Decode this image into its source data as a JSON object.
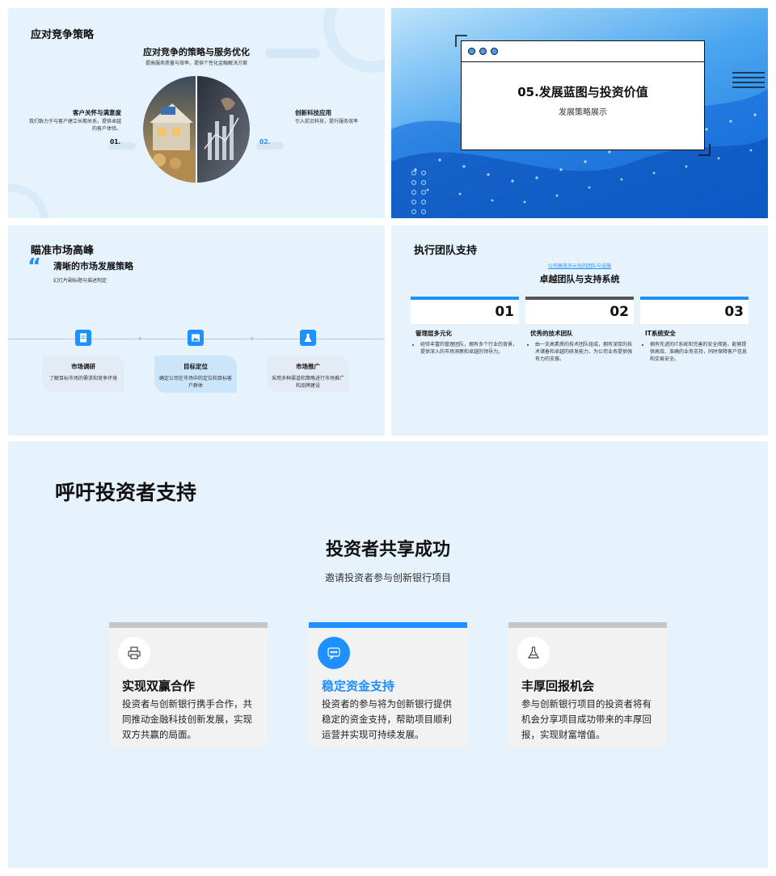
{
  "slide1": {
    "heading": "应对竞争策略",
    "title": "应对竞争的策略与服务优化",
    "subtitle": "提高服务质量与效率，提供个性化金融解决方案",
    "left": {
      "title": "客户关怀与满意度",
      "desc": "我们致力于与客户建立长期关系，提供卓越的客户体验。",
      "num": "01."
    },
    "right": {
      "title": "创新科技应用",
      "desc": "引入前沿科技，提升服务效率",
      "num": "02."
    },
    "colors": {
      "accent": "#1e90ff",
      "bg": "#e6f3fd"
    }
  },
  "slide2": {
    "title": "05.发展蓝图与投资价值",
    "subtitle": "发展策略展示"
  },
  "slide3": {
    "heading": "瞄准市场高峰",
    "quote_icon": "quote-icon",
    "title": "清晰的市场发展策略",
    "subtitle": "幻灯片副标题与描述制定",
    "steps": [
      {
        "icon": "document-icon",
        "title": "市场调研",
        "desc": "了解目标市场的需求和竞争环境"
      },
      {
        "icon": "image-icon",
        "title": "目标定位",
        "desc": "确定公司在市场中的定位和目标客户群体"
      },
      {
        "icon": "flask-icon",
        "title": "市场推广",
        "desc": "采用多种渠道和策略进行市场推广和品牌建设"
      }
    ]
  },
  "slide4": {
    "heading": "执行团队支持",
    "overline": "公司高效多元化的团队与设施",
    "title": "卓越团队与支持系统",
    "cols": [
      {
        "num": "01",
        "title": "管理层多元化",
        "desc": "经验丰富的管理团队，拥有多个行业的背景，提供深入的市场洞察和卓越的领导力。"
      },
      {
        "num": "02",
        "title": "优秀的技术团队",
        "desc": "由一支高素质的技术团队组成，拥有深厚的技术储备和卓越的研发能力，为公司业务提供强有力的支撑。"
      },
      {
        "num": "03",
        "title": "IT系统安全",
        "desc": "拥有先进的IT系统和完善的安全措施，能够提供高效、准确的业务支持，同时保障客户信息和交易安全。"
      }
    ]
  },
  "slide5": {
    "heading": "呼吁投资者支持",
    "title": "投资者共享成功",
    "subtitle": "邀请投资者参与创新银行项目",
    "cards": [
      {
        "icon": "printer-icon",
        "title": "实现双赢合作",
        "desc": "投资者与创新银行携手合作，共同推动金融科技创新发展，实现双方共赢的局面。"
      },
      {
        "icon": "chat-icon",
        "title": "稳定资金支持",
        "desc": "投资者的参与将为创新银行提供稳定的资金支持，帮助项目顺利运营并实现可持续发展。"
      },
      {
        "icon": "flask-icon",
        "title": "丰厚回报机会",
        "desc": "参与创新银行项目的投资者将有机会分享项目成功带来的丰厚回报，实现财富增值。"
      }
    ]
  }
}
